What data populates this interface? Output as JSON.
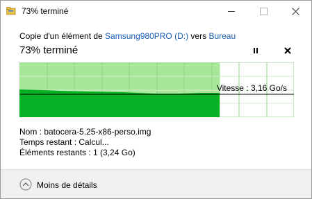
{
  "window": {
    "title": "73% terminé"
  },
  "copy": {
    "prefix": "Copie d'un élément de ",
    "source": "Samsung980PRO (D:)",
    "middle": " vers ",
    "destination": "Bureau"
  },
  "status": {
    "percent_text": "73% terminé",
    "progress_fraction": 0.73,
    "speed": "Vitesse : 3,16 Go/s"
  },
  "details": {
    "name_line": "Nom :  batocera-5.25-x86-perso.img",
    "time_line": "Temps restant :  Calcul...",
    "items_line": "Éléments restants :  1 (3,24 Go)"
  },
  "footer": {
    "less_details": "Moins de détails"
  },
  "colors": {
    "progress_light": "#a8e69a",
    "progress_dark": "#06b025",
    "link": "#1a5fb4",
    "footer_bg": "#f0f0f0"
  },
  "icons": {
    "app": "folder-copy-icon",
    "pause": "pause-icon",
    "cancel": "close-icon",
    "collapse": "chevron-up-icon"
  }
}
